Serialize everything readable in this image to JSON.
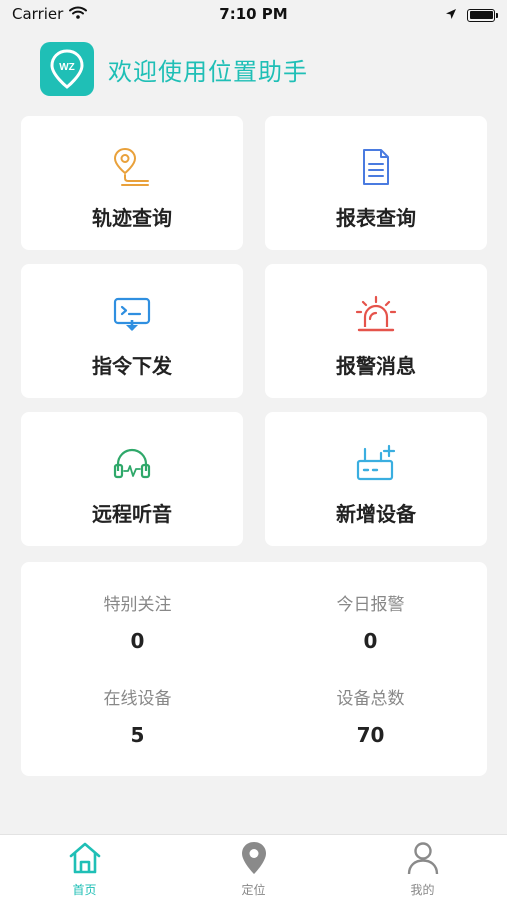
{
  "status_bar": {
    "carrier": "Carrier",
    "time": "7:10 PM"
  },
  "header": {
    "logo_text": "WZ",
    "title": "欢迎使用位置助手"
  },
  "menu": [
    {
      "label": "轨迹查询",
      "icon": "location-track-icon",
      "color": "#e9a13b"
    },
    {
      "label": "报表查询",
      "icon": "document-icon",
      "color": "#4a7be0"
    },
    {
      "label": "指令下发",
      "icon": "command-monitor-icon",
      "color": "#2f8fe0"
    },
    {
      "label": "报警消息",
      "icon": "siren-icon",
      "color": "#e5534b"
    },
    {
      "label": "远程听音",
      "icon": "headphones-icon",
      "color": "#2fa86a"
    },
    {
      "label": "新增设备",
      "icon": "router-add-icon",
      "color": "#3aaee0"
    }
  ],
  "stats": [
    {
      "label": "特别关注",
      "value": "0"
    },
    {
      "label": "今日报警",
      "value": "0"
    },
    {
      "label": "在线设备",
      "value": "5"
    },
    {
      "label": "设备总数",
      "value": "70"
    }
  ],
  "tabs": [
    {
      "label": "首页",
      "icon": "home-icon",
      "active": true
    },
    {
      "label": "定位",
      "icon": "location-pin-icon",
      "active": false
    },
    {
      "label": "我的",
      "icon": "user-icon",
      "active": false
    }
  ],
  "colors": {
    "accent": "#1fbfb6",
    "background": "#f2f2f2",
    "inactive": "#8a8a8a"
  }
}
